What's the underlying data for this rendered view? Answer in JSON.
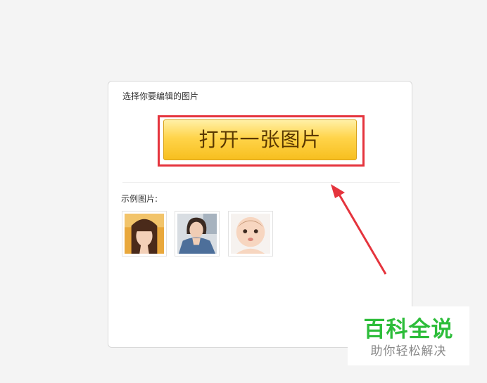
{
  "dialog": {
    "section_title": "选择你要编辑的图片",
    "open_button_label": "打开一张图片",
    "examples_label": "示例图片:",
    "example_images": [
      {
        "icon": "girl-bangs-photo-thumbnail"
      },
      {
        "icon": "girl-denim-jacket-photo-thumbnail"
      },
      {
        "icon": "baby-photo-thumbnail"
      }
    ]
  },
  "annotation": {
    "highlight_color": "#e5343d",
    "arrow_color": "#e5343d"
  },
  "watermark": {
    "title": "百科全说",
    "subtitle": "助你轻松解决"
  },
  "colors": {
    "button_gradient_top": "#fff0a6",
    "button_gradient_bottom": "#f7bf1f",
    "watermark_green": "#2dbd3a"
  }
}
